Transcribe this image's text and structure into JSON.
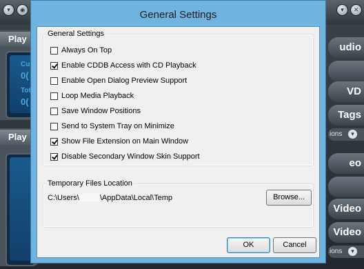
{
  "dialog": {
    "title": "General Settings",
    "group_general": "General Settings",
    "checkboxes": [
      {
        "label": "Always On Top",
        "checked": false
      },
      {
        "label": "Enable CDDB Access with CD Playback",
        "checked": true
      },
      {
        "label": "Enable Open Dialog Preview Support",
        "checked": false
      },
      {
        "label": "Loop Media Playback",
        "checked": false
      },
      {
        "label": "Save Window Positions",
        "checked": false
      },
      {
        "label": "Send to System Tray on Minimize",
        "checked": false
      },
      {
        "label": "Show File Extension on Main Window",
        "checked": true
      },
      {
        "label": "Disable Secondary Window Skin Support",
        "checked": true
      }
    ],
    "group_temp": "Temporary Files Location",
    "temp_path_prefix": "C:\\Users\\",
    "temp_path_suffix": "\\AppData\\Local\\Temp",
    "browse_label": "Browse...",
    "ok_label": "OK",
    "cancel_label": "Cancel"
  },
  "background": {
    "left_tab_1": "Play",
    "left_tab_2": "Play",
    "screen_text_1": "Cu",
    "screen_text_2": "Tot",
    "screen_digits": "0(",
    "right_buttons": [
      "udio",
      "VD",
      "Tags",
      "eo",
      "Video",
      "Video"
    ],
    "right_small": [
      "ions",
      "ions"
    ]
  },
  "colors": {
    "dialog_frame": "#6fb3df",
    "client_bg": "#f0f0f0",
    "skin_bg": "#2a3036"
  }
}
